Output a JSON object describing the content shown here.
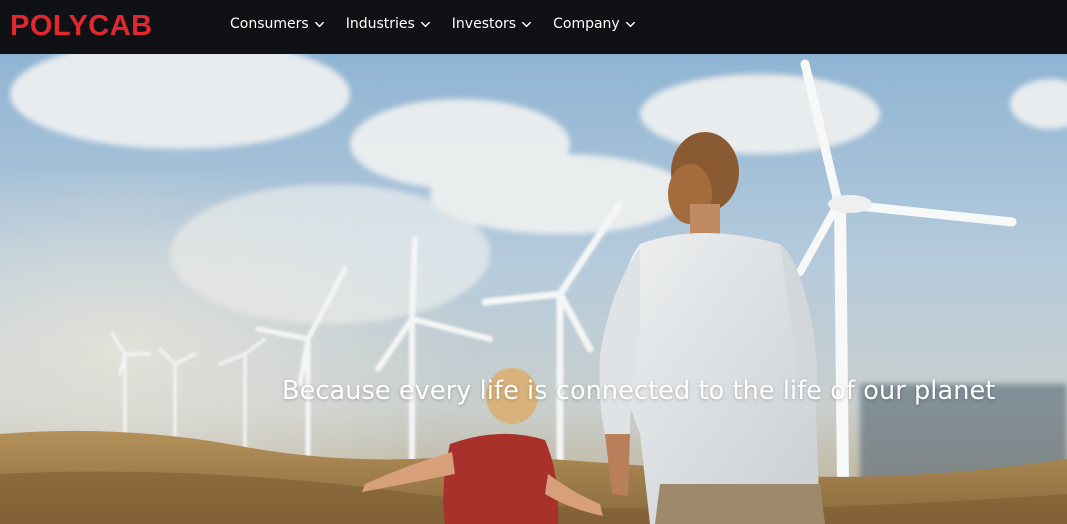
{
  "brand": {
    "name": "POLYCAB",
    "color": "#e3262f"
  },
  "nav": {
    "items": [
      {
        "label": "Consumers",
        "icon": "chevron-down-icon"
      },
      {
        "label": "Industries",
        "icon": "chevron-down-icon"
      },
      {
        "label": "Investors",
        "icon": "chevron-down-icon"
      },
      {
        "label": "Company",
        "icon": "chevron-down-icon"
      }
    ]
  },
  "hero": {
    "tagline": "Because every life is connected to the life of our planet"
  },
  "colors": {
    "topbar_bg": "#0f1114",
    "nav_text": "#ffffff",
    "sky": "#a9c4dc",
    "hills": "#b48a4c"
  }
}
